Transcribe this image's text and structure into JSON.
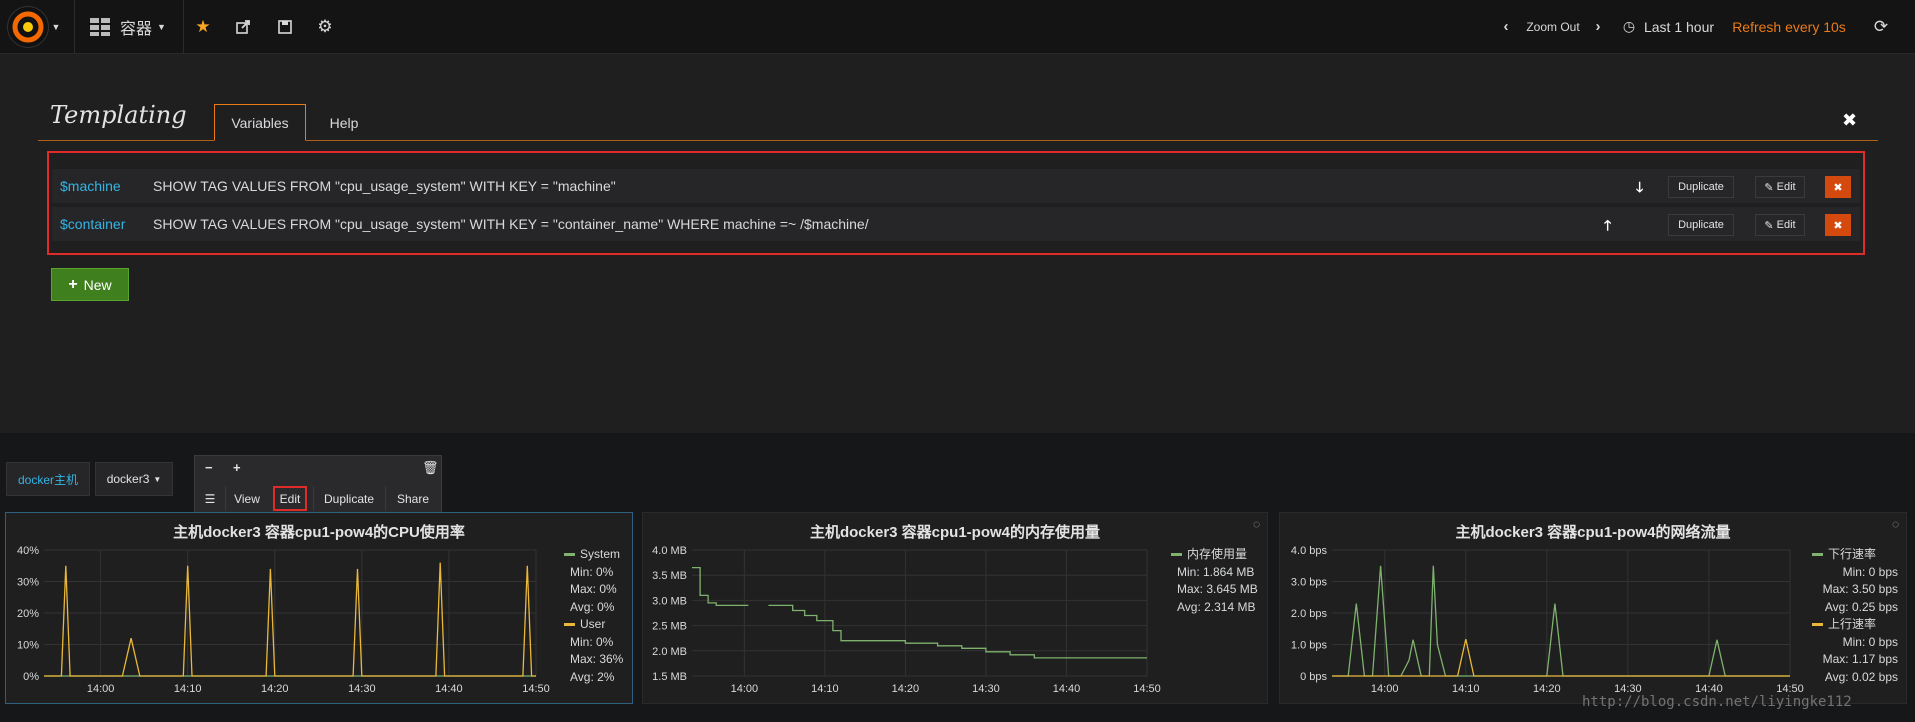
{
  "navbar": {
    "dashboard_title": "容器",
    "zoom_out": "Zoom Out",
    "time_range": "Last 1 hour",
    "refresh": "Refresh every 10s"
  },
  "templating": {
    "title": "Templating",
    "tabs": [
      "Variables",
      "Help"
    ],
    "variables": [
      {
        "name": "$machine",
        "query": "SHOW TAG VALUES FROM \"cpu_usage_system\" WITH KEY = \"machine\"",
        "move": "down"
      },
      {
        "name": "$container",
        "query": "SHOW TAG VALUES FROM \"cpu_usage_system\" WITH KEY = \"container_name\" WHERE machine =~ /$machine/",
        "move": "up"
      }
    ],
    "duplicate_label": "Duplicate",
    "edit_label": "Edit",
    "new_label": "New"
  },
  "dashboard": {
    "var_label": "docker主机",
    "var_value": "docker3",
    "panel_menu": [
      "View",
      "Edit",
      "Duplicate",
      "Share"
    ]
  },
  "panels": [
    {
      "title": "主机docker3 容器cpu1-pow4的CPU使用率",
      "legend": [
        {
          "name": "System",
          "color": "#7eb26d",
          "stats": [
            "Min: 0%",
            "Max: 0%",
            "Avg: 0%"
          ]
        },
        {
          "name": "User",
          "color": "#eab839",
          "stats": [
            "Min: 0%",
            "Max: 36%",
            "Avg: 2%"
          ]
        }
      ]
    },
    {
      "title": "主机docker3 容器cpu1-pow4的内存使用量",
      "legend": [
        {
          "name": "内存使用量",
          "color": "#7eb26d",
          "stats": [
            "Min: 1.864 MB",
            "Max: 3.645 MB",
            "Avg: 2.314 MB"
          ]
        }
      ]
    },
    {
      "title": "主机docker3 容器cpu1-pow4的网络流量",
      "legend": [
        {
          "name": "下行速率",
          "color": "#7eb26d",
          "stats": [
            "Min: 0 bps",
            "Max: 3.50 bps",
            "Avg: 0.25 bps"
          ]
        },
        {
          "name": "上行速率",
          "color": "#eab839",
          "stats": [
            "Min: 0 bps",
            "Max: 1.17 bps",
            "Avg: 0.02 bps"
          ]
        }
      ]
    }
  ],
  "chart_data": [
    {
      "type": "line",
      "title": "主机docker3 容器cpu1-pow4的CPU使用率",
      "x_ticks": [
        "14:00",
        "14:10",
        "14:20",
        "14:30",
        "14:40",
        "14:50"
      ],
      "x_range_min": [
        -6.5,
        50
      ],
      "y_ticks": [
        "0%",
        "10%",
        "20%",
        "30%",
        "40%"
      ],
      "ylim": [
        0,
        40
      ],
      "series": [
        {
          "name": "System",
          "color": "#7eb26d",
          "x": [
            -6.5,
            50
          ],
          "y": [
            0,
            0
          ]
        },
        {
          "name": "User",
          "color": "#eab839",
          "x": [
            -6.5,
            -4.5,
            -4,
            -3.5,
            2.5,
            3.5,
            4.5,
            9.5,
            10,
            10.5,
            19,
            19.5,
            20,
            29,
            29.5,
            30,
            38.5,
            39,
            39.5,
            48.5,
            49,
            49.5,
            50
          ],
          "y": [
            0,
            0,
            35,
            0,
            0,
            12,
            0,
            0,
            35,
            0,
            0,
            34,
            0,
            0,
            34,
            0,
            0,
            36,
            0,
            0,
            35,
            0,
            0
          ]
        }
      ]
    },
    {
      "type": "line",
      "title": "主机docker3 容器cpu1-pow4的内存使用量",
      "x_ticks": [
        "14:00",
        "14:10",
        "14:20",
        "14:30",
        "14:40",
        "14:50"
      ],
      "x_range_min": [
        -6.5,
        50
      ],
      "y_ticks": [
        "1.5 MB",
        "2.0 MB",
        "2.5 MB",
        "3.0 MB",
        "3.5 MB",
        "4.0 MB"
      ],
      "ylim": [
        1.5,
        4.0
      ],
      "series": [
        {
          "name": "内存使用量",
          "color": "#7eb26d",
          "segments": [
            {
              "x": [
                -6.5,
                -5.5,
                -5.5,
                -4.5,
                -4.5,
                -3.5,
                -3.5,
                0.5
              ],
              "y": [
                3.65,
                3.65,
                3.1,
                3.1,
                2.95,
                2.95,
                2.9,
                2.9
              ]
            },
            {
              "x": [
                3,
                6,
                6,
                7.5,
                7.5,
                9,
                9,
                11,
                11,
                12,
                12,
                20,
                20,
                24,
                24,
                27,
                27,
                30,
                30,
                33,
                33,
                36,
                36,
                50
              ],
              "y": [
                2.9,
                2.9,
                2.8,
                2.8,
                2.7,
                2.7,
                2.6,
                2.6,
                2.4,
                2.4,
                2.2,
                2.2,
                2.15,
                2.15,
                2.1,
                2.1,
                2.05,
                2.05,
                1.98,
                1.98,
                1.92,
                1.92,
                1.86,
                1.86
              ]
            }
          ]
        }
      ]
    },
    {
      "type": "line",
      "title": "主机docker3 容器cpu1-pow4的网络流量",
      "x_ticks": [
        "14:00",
        "14:10",
        "14:20",
        "14:30",
        "14:40",
        "14:50"
      ],
      "x_range_min": [
        -6.5,
        50
      ],
      "y_ticks": [
        "0 bps",
        "1.0 bps",
        "2.0 bps",
        "3.0 bps",
        "4.0 bps"
      ],
      "ylim": [
        0,
        4
      ],
      "series": [
        {
          "name": "下行速率",
          "color": "#7eb26d",
          "x": [
            -6.5,
            -4.5,
            -3.5,
            -2.5,
            -1.5,
            -0.5,
            0.5,
            2,
            3,
            3.5,
            4.5,
            5.5,
            6,
            6.5,
            7.5,
            8,
            8.5,
            20,
            21,
            22,
            40,
            41,
            42,
            50
          ],
          "y": [
            0,
            0,
            2.3,
            0,
            0,
            3.5,
            0,
            0,
            0.5,
            1.15,
            0,
            0,
            3.5,
            1,
            0,
            0,
            0,
            0,
            2.3,
            0,
            0,
            1.15,
            0,
            0
          ]
        },
        {
          "name": "上行速率",
          "color": "#eab839",
          "x": [
            -6.5,
            9,
            10,
            11,
            50
          ],
          "y": [
            0,
            0,
            1.17,
            0,
            0
          ]
        }
      ]
    }
  ],
  "watermark": "http://blog.csdn.net/liyingke112"
}
